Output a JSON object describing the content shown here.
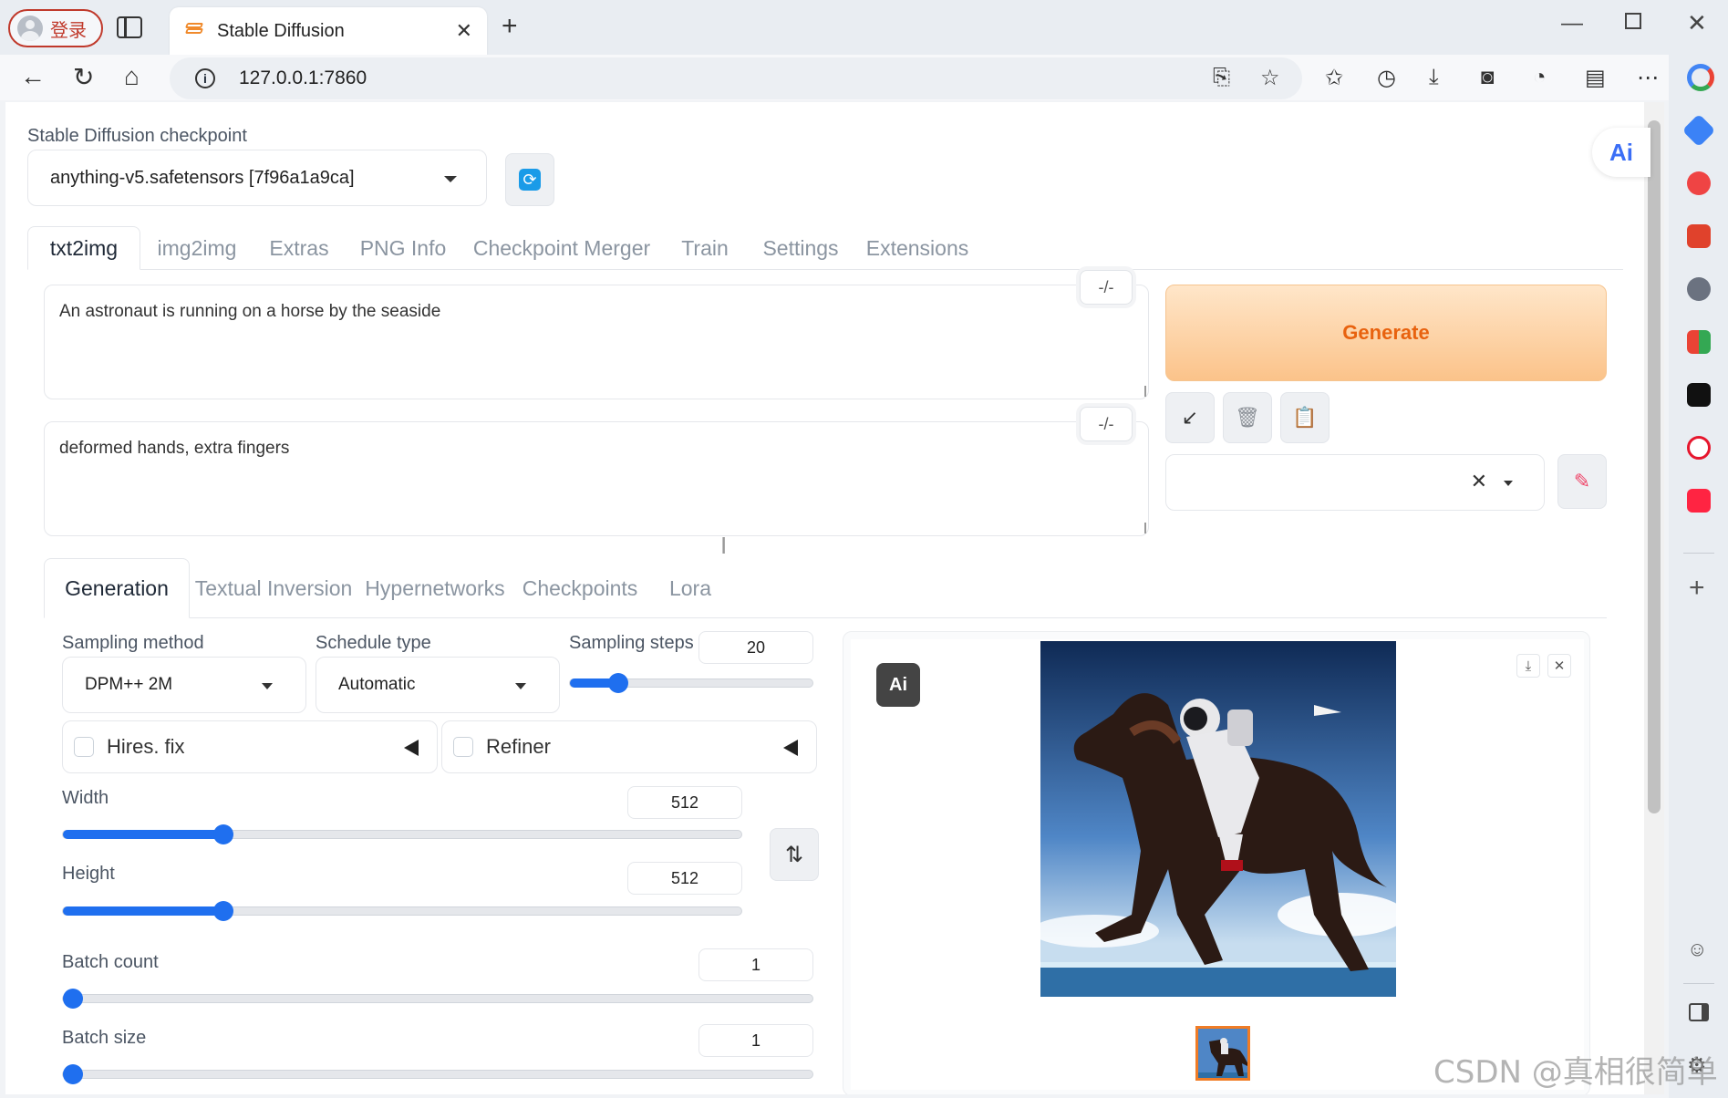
{
  "browser": {
    "profile_label": "登录",
    "tab_title": "Stable Diffusion",
    "url": "127.0.0.1:7860"
  },
  "page": {
    "checkpoint_label": "Stable Diffusion checkpoint",
    "checkpoint_value": "anything-v5.safetensors [7f96a1a9ca]",
    "main_tabs": [
      "txt2img",
      "img2img",
      "Extras",
      "PNG Info",
      "Checkpoint Merger",
      "Train",
      "Settings",
      "Extensions"
    ],
    "active_main_tab": "txt2img",
    "prompt": "An astronaut is running on a horse by the seaside",
    "negative_prompt": "deformed hands, extra fingers",
    "token_counter": "-/-",
    "generate_label": "Generate",
    "sub_tabs": [
      "Generation",
      "Textual Inversion",
      "Hypernetworks",
      "Checkpoints",
      "Lora"
    ],
    "sampling_method_label": "Sampling method",
    "sampling_method_value": "DPM++ 2M",
    "schedule_type_label": "Schedule type",
    "schedule_type_value": "Automatic",
    "sampling_steps_label": "Sampling steps",
    "sampling_steps_value": "20",
    "hires_fix_label": "Hires. fix",
    "refiner_label": "Refiner",
    "width_label": "Width",
    "width_value": "512",
    "height_label": "Height",
    "height_value": "512",
    "batch_count_label": "Batch count",
    "batch_count_value": "1",
    "batch_size_label": "Batch size",
    "batch_size_value": "1",
    "ai_badge": "Ai",
    "watermark": "CSDN @真相很简单"
  },
  "colors": {
    "accent_blue": "#1f6fef",
    "generate_text": "#e8620f",
    "generate_bg": "#fbc38a"
  },
  "slider_levels": {
    "sampling_steps_fraction": 0.2,
    "width_fraction": 0.236,
    "height_fraction": 0.236,
    "batch_count_fraction": 0.0,
    "batch_size_fraction": 0.0
  }
}
